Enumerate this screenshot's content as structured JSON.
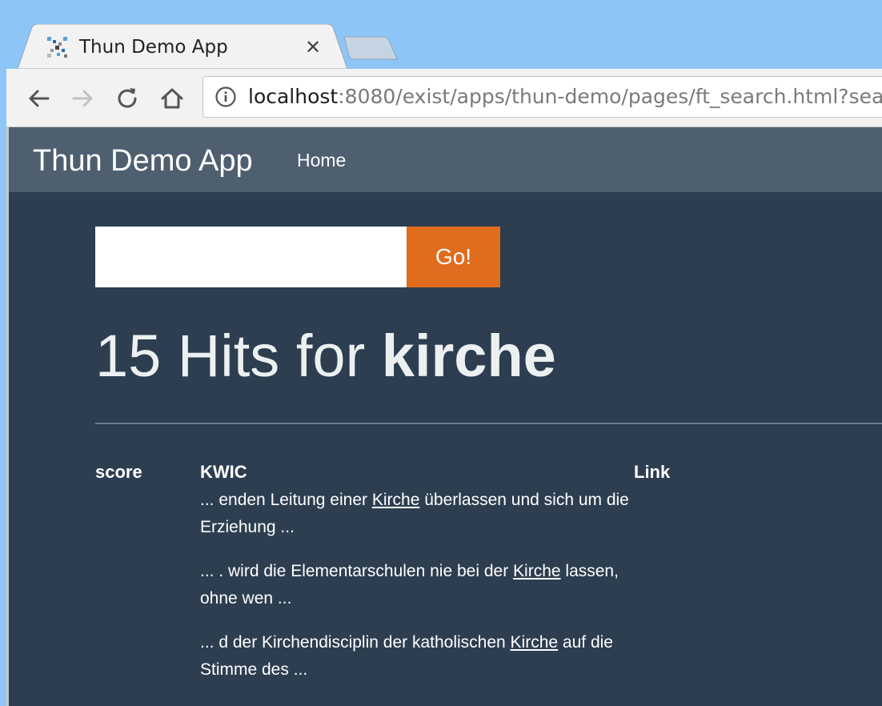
{
  "browser": {
    "tab": {
      "title": "Thun Demo App",
      "close_glyph": "✕",
      "favicon": "app-favicon-icon"
    },
    "address_bar": {
      "host": "localhost",
      "rest": ":8080/exist/apps/thun-demo/pages/ft_search.html?sear"
    },
    "colors": {
      "titlebar": "#8ec5f7",
      "toolbar": "#f2f2f2"
    }
  },
  "navbar": {
    "brand": "Thun Demo App",
    "home": "Home"
  },
  "search": {
    "value": "",
    "button_label": "Go!"
  },
  "results": {
    "heading_prefix": "15 Hits for ",
    "query": "kirche",
    "columns": [
      "score",
      "KWIC",
      "Link"
    ],
    "rows": [
      {
        "before": "... enden Leitung einer ",
        "match": "Kirche",
        "after": " überlassen und sich um die Erziehung ..."
      },
      {
        "before": "... . wird die Elementarschulen nie bei der ",
        "match": "Kirche",
        "after": " lassen, ohne wen ..."
      },
      {
        "before": "... d der Kirchendisciplin der katholischen ",
        "match": "Kirche",
        "after": " auf die Stimme des ..."
      }
    ]
  },
  "theme": {
    "page_bg": "#2c3e50",
    "navbar_bg": "#4e5f6f",
    "accent": "#e06c1e",
    "text": "#ffffff"
  }
}
